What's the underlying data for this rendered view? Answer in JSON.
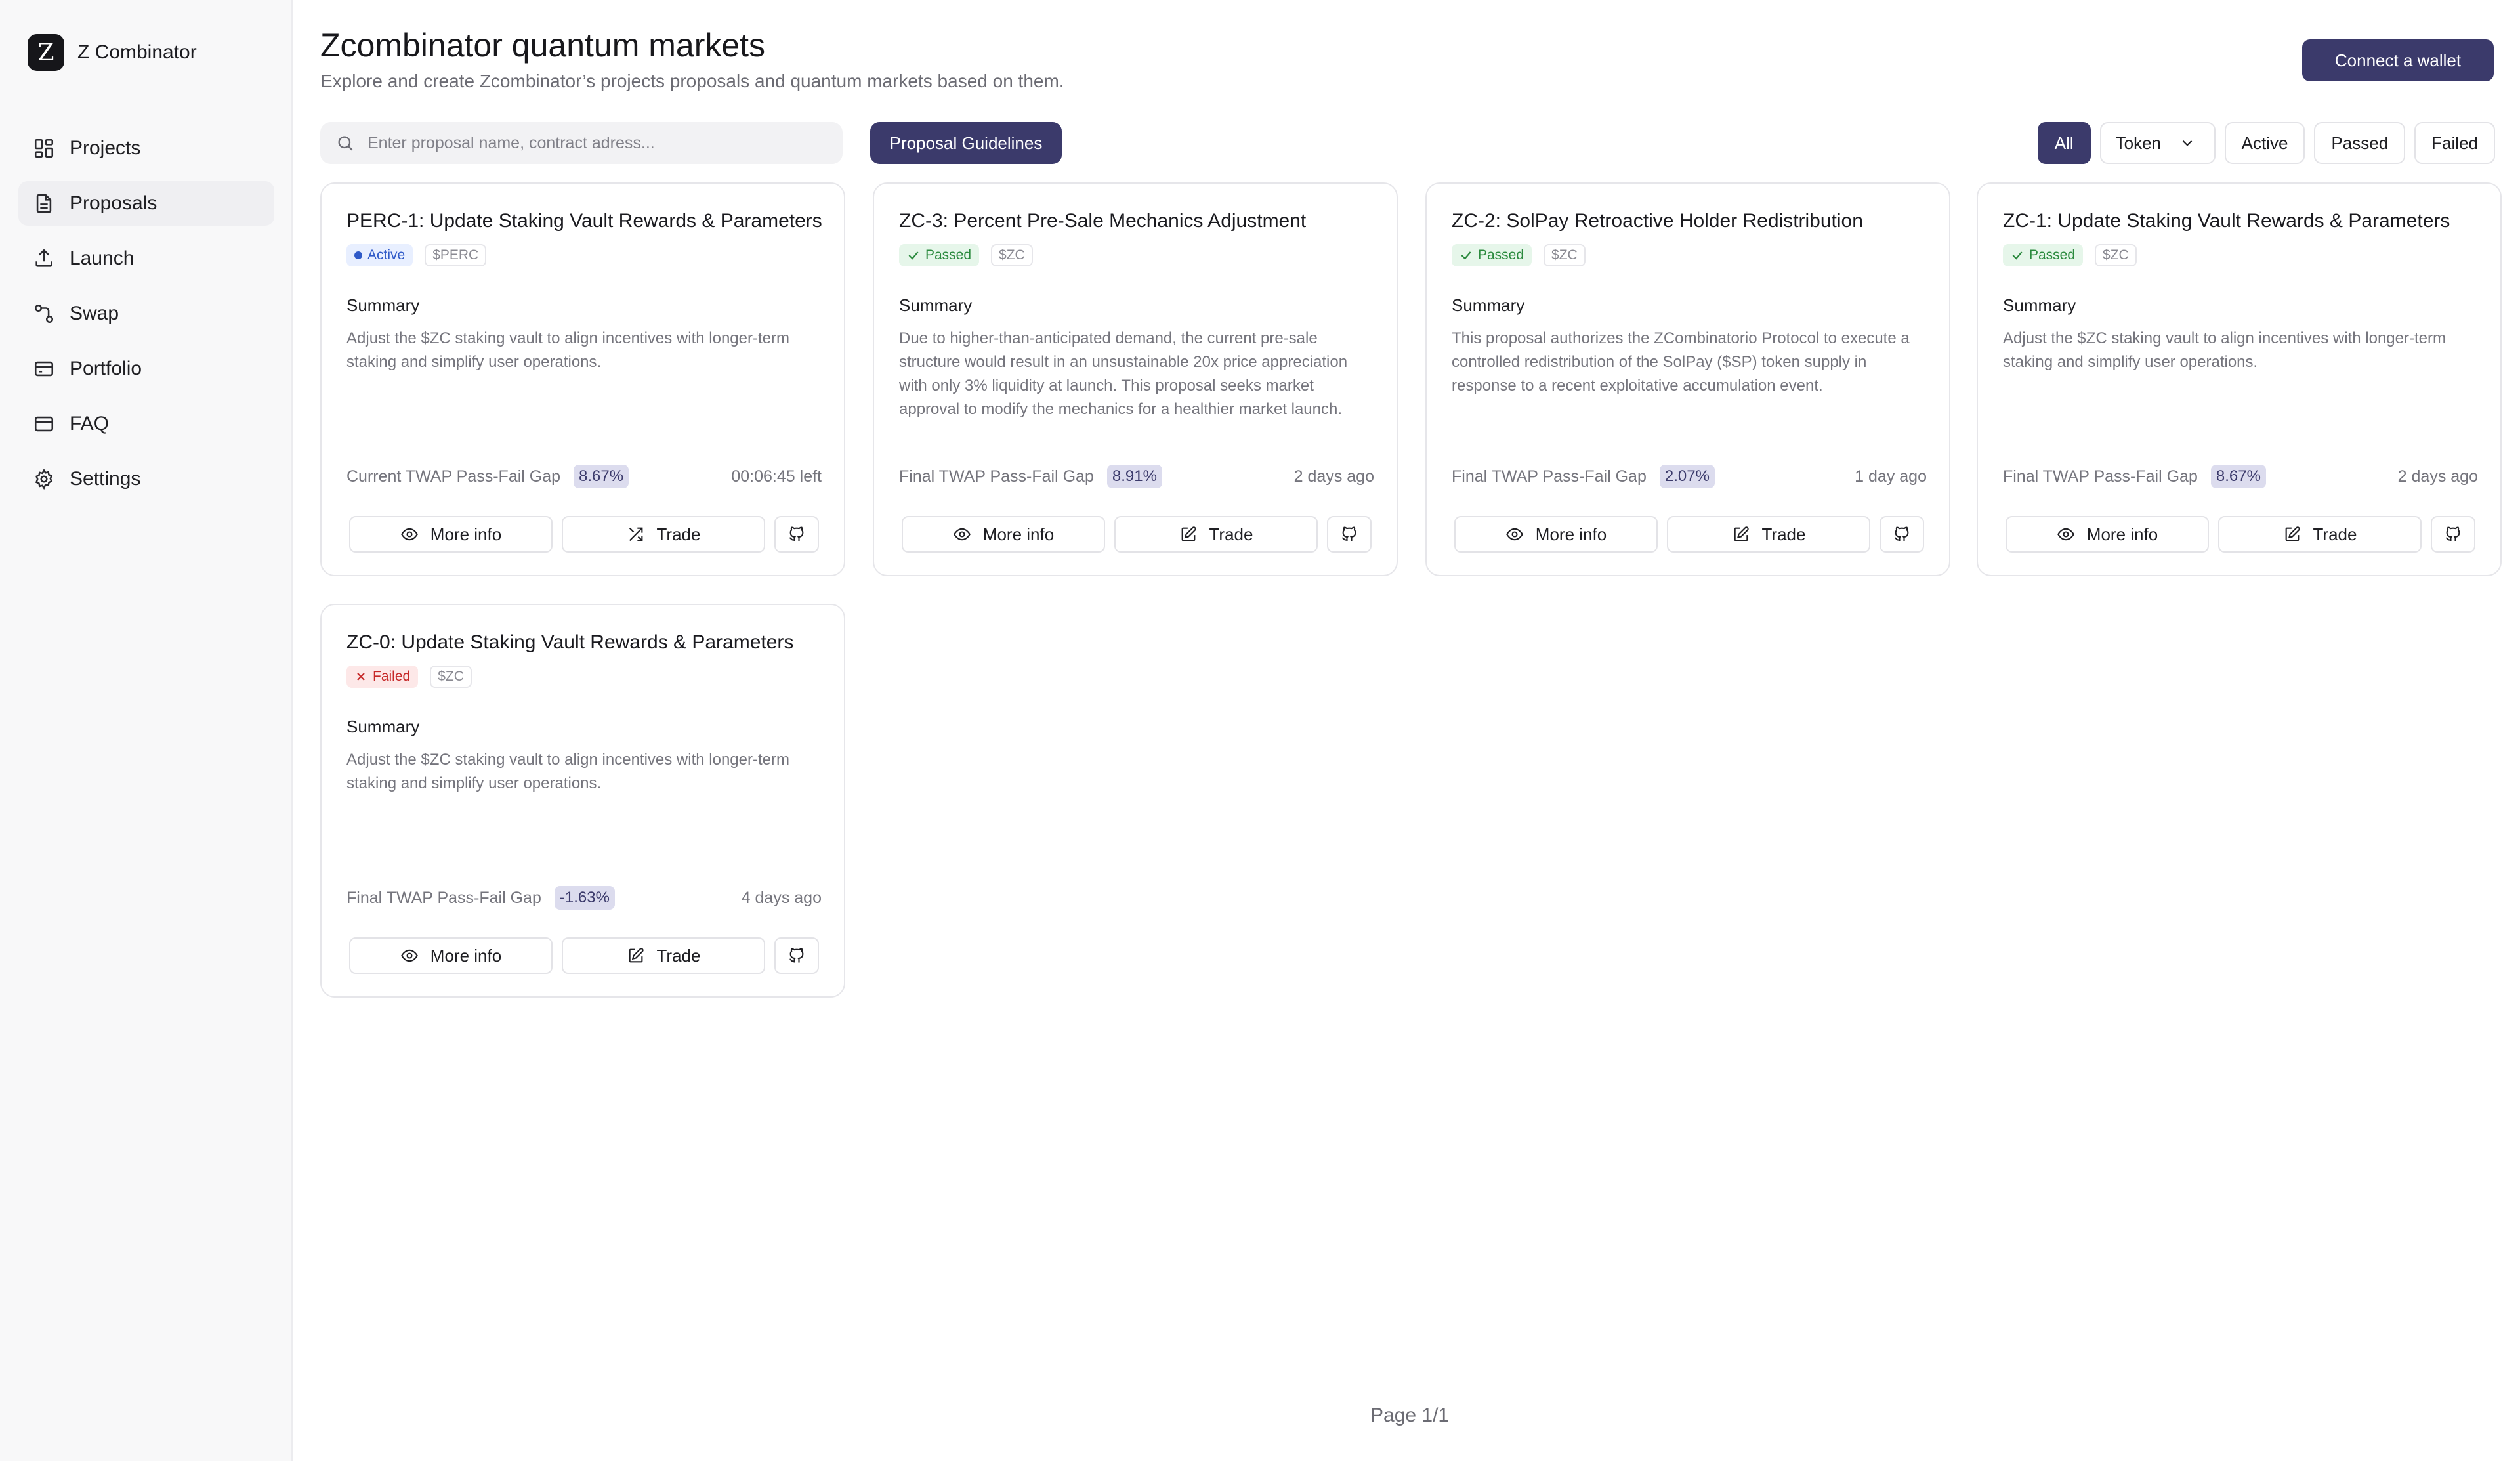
{
  "brand": {
    "logo_letter": "Z",
    "name": "Z Combinator"
  },
  "sidebar": {
    "items": [
      {
        "label": "Projects",
        "icon": "grid-icon"
      },
      {
        "label": "Proposals",
        "icon": "document-icon",
        "active": true
      },
      {
        "label": "Launch",
        "icon": "upload-icon"
      },
      {
        "label": "Swap",
        "icon": "swap-icon"
      },
      {
        "label": "Portfolio",
        "icon": "wallet-icon"
      },
      {
        "label": "FAQ",
        "icon": "card-icon"
      },
      {
        "label": "Settings",
        "icon": "gear-icon"
      }
    ]
  },
  "header": {
    "title": "Zcombinator quantum markets",
    "subtitle": "Explore and create Zcombinator’s projects proposals and quantum markets based on them.",
    "connect_label": "Connect a wallet"
  },
  "toolbar": {
    "search_placeholder": "Enter proposal name, contract adress...",
    "guidelines_label": "Proposal Guidelines",
    "filters": {
      "all": "All",
      "token": "Token",
      "active": "Active",
      "passed": "Passed",
      "failed": "Failed"
    }
  },
  "proposals": [
    {
      "title": "PERC-1: Update Staking Vault Rewards & Parameters",
      "status": "Active",
      "ticker": "$PERC",
      "summary_heading": "Summary",
      "summary": "Adjust the $ZC staking vault to align incentives with longer-term staking and simplify user operations.",
      "metric_label": "Current TWAP Pass-Fail Gap",
      "metric_value": "8.67%",
      "time": "00:06:45 left"
    },
    {
      "title": "ZC-3: Percent Pre-Sale Mechanics Adjustment",
      "status": "Passed",
      "ticker": "$ZC",
      "summary_heading": "Summary",
      "summary": "Due to higher-than-anticipated demand, the current pre-sale structure would result in an unsustainable 20x price appreciation with only 3% liquidity at launch. This proposal seeks market approval to modify the mechanics for a healthier market launch.",
      "metric_label": "Final TWAP Pass-Fail Gap",
      "metric_value": "8.91%",
      "time": "2 days ago"
    },
    {
      "title": "ZC-2: SolPay Retroactive Holder Redistribution",
      "status": "Passed",
      "ticker": "$ZC",
      "summary_heading": "Summary",
      "summary": "This proposal authorizes the ZCombinatorio Protocol to execute a controlled redistribution of the SolPay ($SP) token supply in response to a recent exploitative accumulation event.",
      "metric_label": "Final TWAP Pass-Fail Gap",
      "metric_value": "2.07%",
      "time": "1 day ago"
    },
    {
      "title": "ZC-1: Update Staking Vault Rewards & Parameters",
      "status": "Passed",
      "ticker": "$ZC",
      "summary_heading": "Summary",
      "summary": "Adjust the $ZC staking vault to align incentives with longer-term staking and simplify user operations.",
      "metric_label": "Final TWAP Pass-Fail Gap",
      "metric_value": "8.67%",
      "time": "2 days ago"
    },
    {
      "title": "ZC-0: Update Staking Vault Rewards & Parameters",
      "status": "Failed",
      "ticker": "$ZC",
      "summary_heading": "Summary",
      "summary": "Adjust the $ZC staking vault to align incentives with longer-term staking and simplify user operations.",
      "metric_label": "Final TWAP Pass-Fail Gap",
      "metric_value": "-1.63%",
      "time": "4 days ago"
    }
  ],
  "card_actions": {
    "more_info": "More info",
    "trade": "Trade"
  },
  "pagination": {
    "label": "Page 1/1"
  }
}
